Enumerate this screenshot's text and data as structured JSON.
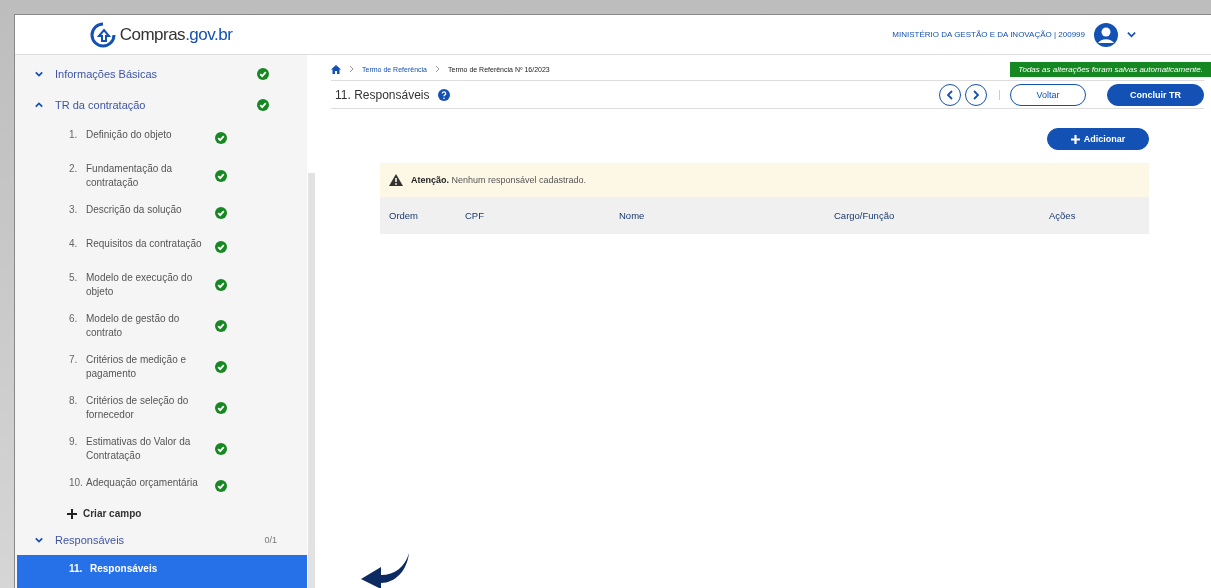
{
  "header": {
    "logo": {
      "name": "Compras",
      "suffix": ".gov.br"
    },
    "org": "MINISTÉRIO DA GESTÃO E DA INOVAÇÃO | 200999"
  },
  "sidebar": {
    "sections": [
      {
        "label": "Informações Básicas",
        "expanded": false,
        "complete": true
      },
      {
        "label": "TR da contratação",
        "expanded": true,
        "complete": true,
        "add_label": "Criar campo",
        "children": [
          {
            "number": "1.",
            "label": "Definição do objeto",
            "complete": true,
            "selected": false
          },
          {
            "number": "2.",
            "label": "Fundamentação da contratação",
            "complete": true,
            "selected": false
          },
          {
            "number": "3.",
            "label": "Descrição da solução",
            "complete": true,
            "selected": false
          },
          {
            "number": "4.",
            "label": "Requisitos da contratação",
            "complete": true,
            "selected": false
          },
          {
            "number": "5.",
            "label": "Modelo de execução do objeto",
            "complete": true,
            "selected": false
          },
          {
            "number": "6.",
            "label": "Modelo de gestão do contrato",
            "complete": true,
            "selected": false
          },
          {
            "number": "7.",
            "label": "Critérios de medição e pagamento",
            "complete": true,
            "selected": false
          },
          {
            "number": "8.",
            "label": "Critérios de seleção do fornecedor",
            "complete": true,
            "selected": false
          },
          {
            "number": "9.",
            "label": "Estimativas do Valor da Contratação",
            "complete": true,
            "selected": false
          },
          {
            "number": "10.",
            "label": "Adequação orçamentária",
            "complete": true,
            "selected": false
          }
        ]
      },
      {
        "label": "Responsáveis",
        "expanded": false,
        "complete": false,
        "count": "0/1",
        "children": [
          {
            "number": "11.",
            "label": "Responsáveis",
            "complete": false,
            "selected": true
          }
        ]
      }
    ]
  },
  "breadcrumb": [
    {
      "label": "Termo de Referência",
      "current": false
    },
    {
      "label": "Termo de Referência Nº 16/2023",
      "current": true
    }
  ],
  "save_status": "Todas as alterações foram salvas automaticamente.",
  "page_title": "11. Responsáveis",
  "buttons": {
    "back": "Voltar",
    "finish": "Concluir TR",
    "add": "Adicionar"
  },
  "alert": "**Atenção.** Nenhum responsável cadastrado.",
  "table": {
    "columns": [
      "Ordem",
      "CPF",
      "Nome",
      "Cargo/Função",
      "Ações"
    ]
  }
}
